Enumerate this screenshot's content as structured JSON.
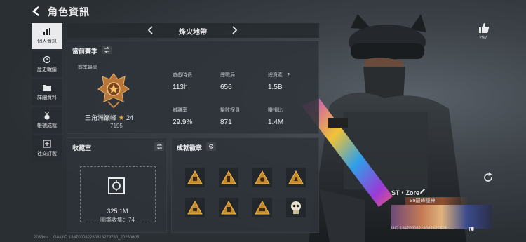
{
  "header": {
    "title": "角色資訊"
  },
  "sidebar": {
    "items": [
      {
        "label": "個人資訊",
        "icon": "bar-chart-icon",
        "active": true
      },
      {
        "label": "歷史戰績",
        "icon": "history-clock-icon",
        "active": false
      },
      {
        "label": "詳細資料",
        "icon": "folder-icon",
        "active": false
      },
      {
        "label": "帳號成就",
        "icon": "medal-icon",
        "active": false
      },
      {
        "label": "社交訂製",
        "icon": "social-customize-icon",
        "active": false
      }
    ]
  },
  "map_selector": {
    "label": "烽火地帶"
  },
  "season": {
    "heading": "當前賽季",
    "best_label": "賽季最高",
    "rank_name": "三角洲巔峰",
    "rank_level": "24",
    "rank_score": "7195",
    "stats": [
      {
        "label": "遊戲時長",
        "value": "113h"
      },
      {
        "label": "總戰局",
        "value": "656"
      },
      {
        "label": "總資產",
        "value": "1.5B",
        "help": "?"
      },
      {
        "label": "撤離率",
        "value": "29.9%"
      },
      {
        "label": "擊敗探員",
        "value": "871"
      },
      {
        "label": "賺損比",
        "value": "1.4M"
      }
    ]
  },
  "collection": {
    "heading": "收藏室",
    "value": "325.1M",
    "count_text": "圖鑑收集：74"
  },
  "achievements": {
    "heading": "成就徽章"
  },
  "social": {
    "like_count": "297"
  },
  "player": {
    "name": "ST・Zore",
    "title": "S9巔峰穩神",
    "uid": "UID:18470008228081627976"
  },
  "footer": {
    "ping": "2033ms",
    "build": "GA UID:184700082280816279760_20260605"
  },
  "colors": {
    "accent": "#e8a33a",
    "panel": "#2d3339",
    "active_nav": "#e9ebec"
  }
}
